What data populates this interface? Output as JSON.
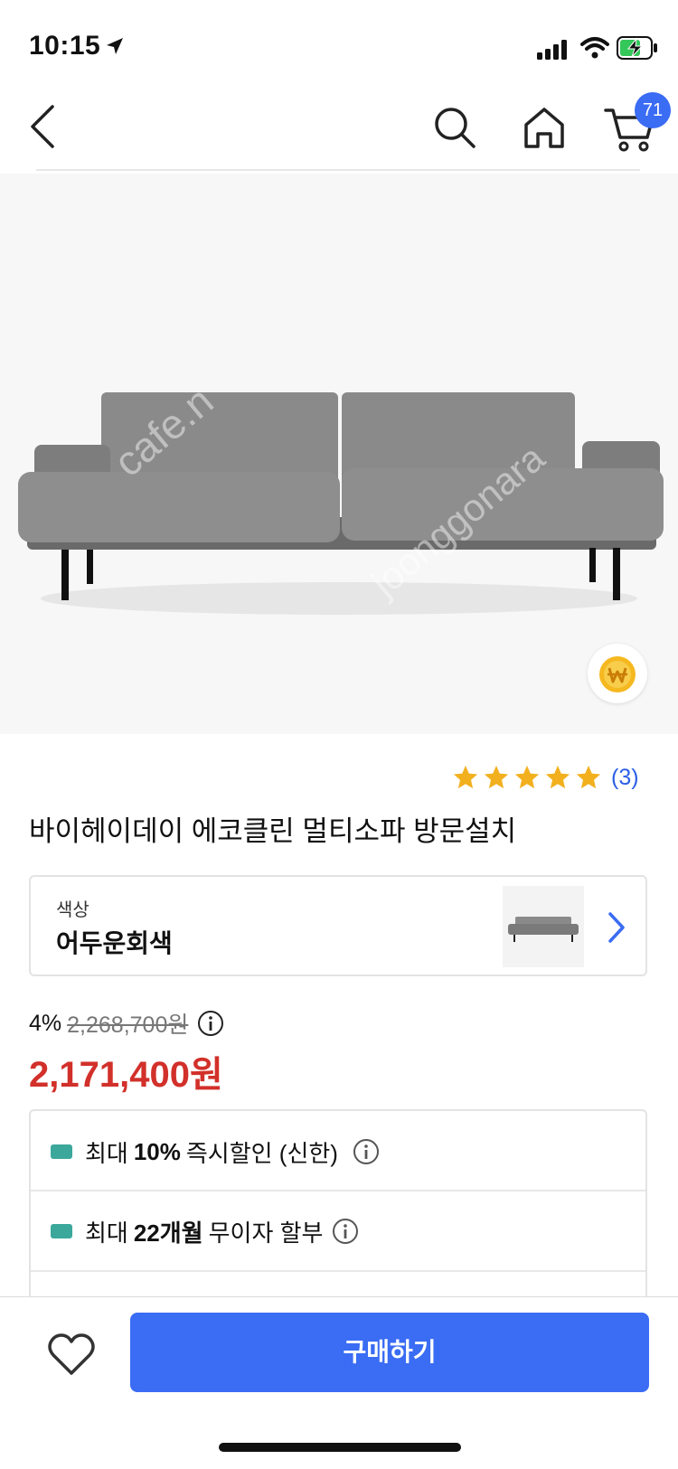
{
  "status_bar": {
    "time": "10:15"
  },
  "header": {
    "cart_count": "71"
  },
  "product": {
    "title": "바이헤이데이 에코클린 멀티소파 방문설치",
    "rating": {
      "stars": 5,
      "review_count": "(3)"
    },
    "watermarks": [
      "cafe.n",
      "joonggonara"
    ]
  },
  "option": {
    "label": "색상",
    "value": "어두운회색"
  },
  "price": {
    "discount": "4%",
    "original": "2,268,700원",
    "sale": "2,171,400원"
  },
  "benefits": [
    {
      "prefix": "최대",
      "highlight": "10%",
      "suffix": "즉시할인 (신한)"
    },
    {
      "prefix": "최대",
      "highlight": "22개월",
      "suffix": "무이자 할부"
    }
  ],
  "bottom_bar": {
    "buy_label": "구매하기"
  },
  "colors": {
    "accent": "#3a6cf4",
    "sale_price": "#d2302a",
    "star": "#f2b01e",
    "card": "#3ba89b"
  }
}
